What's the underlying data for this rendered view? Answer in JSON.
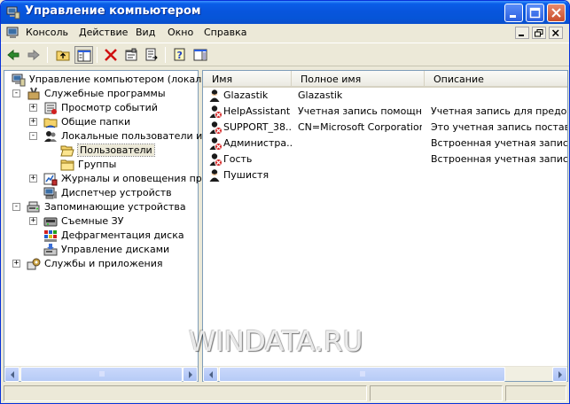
{
  "window": {
    "title": "Управление компьютером"
  },
  "menu": [
    "Консоль",
    "Действие",
    "Вид",
    "Окно",
    "Справка"
  ],
  "tree": [
    {
      "label": "Управление компьютером (локальны",
      "icon": "computer-management-icon",
      "level": 0,
      "expander": ""
    },
    {
      "label": "Служебные программы",
      "icon": "tools-icon",
      "level": 1,
      "expander": "-"
    },
    {
      "label": "Просмотр событий",
      "icon": "event-viewer-icon",
      "level": 2,
      "expander": "+"
    },
    {
      "label": "Общие папки",
      "icon": "shared-folders-icon",
      "level": 2,
      "expander": "+"
    },
    {
      "label": "Локальные пользователи и гр",
      "icon": "local-users-icon",
      "level": 2,
      "expander": "-"
    },
    {
      "label": "Пользователи",
      "icon": "folder-open-icon",
      "level": 3,
      "expander": "",
      "selected": true
    },
    {
      "label": "Группы",
      "icon": "folder-icon",
      "level": 3,
      "expander": ""
    },
    {
      "label": "Журналы и оповещения произ",
      "icon": "performance-logs-icon",
      "level": 2,
      "expander": "+"
    },
    {
      "label": "Диспетчер устройств",
      "icon": "device-manager-icon",
      "level": 2,
      "expander": ""
    },
    {
      "label": "Запоминающие устройства",
      "icon": "storage-icon",
      "level": 1,
      "expander": "-"
    },
    {
      "label": "Съемные ЗУ",
      "icon": "removable-storage-icon",
      "level": 2,
      "expander": "+"
    },
    {
      "label": "Дефрагментация диска",
      "icon": "defrag-icon",
      "level": 2,
      "expander": ""
    },
    {
      "label": "Управление дисками",
      "icon": "disk-management-icon",
      "level": 2,
      "expander": ""
    },
    {
      "label": "Службы и приложения",
      "icon": "services-icon",
      "level": 1,
      "expander": "+"
    }
  ],
  "list": {
    "columns": [
      "Имя",
      "Полное имя",
      "Описание"
    ],
    "rows": [
      {
        "name": "Glazastik",
        "fullname": "Glazastik",
        "description": "",
        "disabled": false
      },
      {
        "name": "HelpAssistant",
        "fullname": "Учетная запись помощн...",
        "description": "Учетная запись для предоста",
        "disabled": true
      },
      {
        "name": "SUPPORT_38...",
        "fullname": "CN=Microsoft Corporation...",
        "description": "Это учетная запись поставщи",
        "disabled": true
      },
      {
        "name": "Администра...",
        "fullname": "",
        "description": "Встроенная учетная запись ад",
        "disabled": true
      },
      {
        "name": "Гость",
        "fullname": "",
        "description": "Встроенная учетная запись д",
        "disabled": true
      },
      {
        "name": "Пушистя",
        "fullname": "",
        "description": "",
        "disabled": false
      }
    ]
  },
  "watermark": "WINDATA.RU"
}
